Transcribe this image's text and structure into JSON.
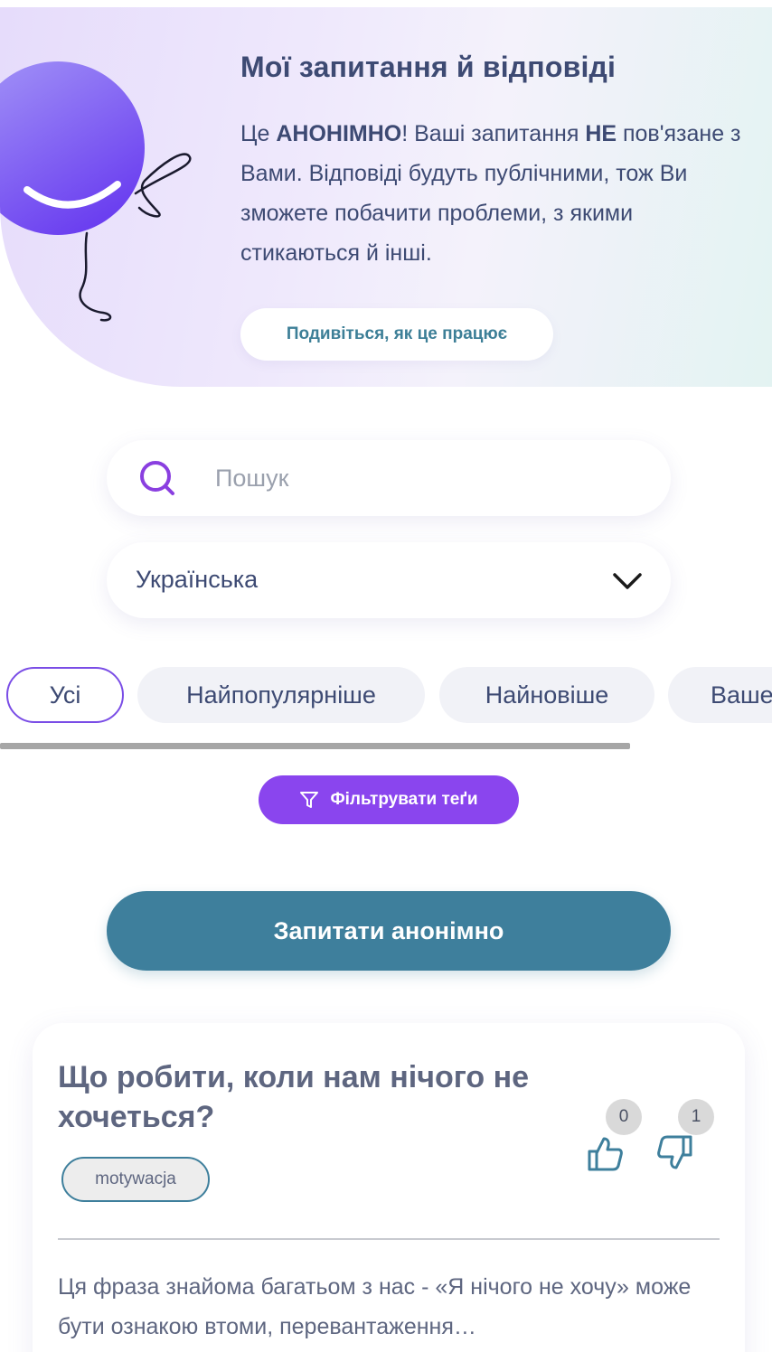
{
  "hero": {
    "title": "Мої запитання й відповіді",
    "text_1": "Це ",
    "text_bold_1": "АНОНІМНО",
    "text_2": "! Ваші запитання ",
    "text_bold_2": "НЕ",
    "text_3": " пов'язане з Вами. Відповіді будуть публічними, тож Ви зможете побачити проблеми, з якими стикаються й інші.",
    "how_button": "Подивіться, як це працює",
    "mascot_icon": "smiling-balloon-mascot"
  },
  "search": {
    "placeholder": "Пошук",
    "icon": "search-icon"
  },
  "language": {
    "value": "Українська",
    "icon": "chevron-down-icon"
  },
  "tabs": [
    {
      "label": "Усі",
      "active": true
    },
    {
      "label": "Найпопулярніше",
      "active": false
    },
    {
      "label": "Найновіше",
      "active": false
    },
    {
      "label": "Ваше",
      "active": false
    }
  ],
  "filter_button": {
    "label": "Фільтрувати теґи",
    "icon": "funnel-icon"
  },
  "ask_button": {
    "label": "Запитати анонімно"
  },
  "question": {
    "title": "Що робити, коли нам нічого не хочеться?",
    "tag": "motywacja",
    "likes": "0",
    "dislikes": "1",
    "excerpt": "Ця фраза знайома багатьом з нас - «Я нічого не хочу» може бути ознакою втоми, перевантаження…"
  },
  "colors": {
    "primary_text": "#3d4a73",
    "accent_purple": "#8a45ee",
    "accent_teal": "#3e7f9c"
  }
}
